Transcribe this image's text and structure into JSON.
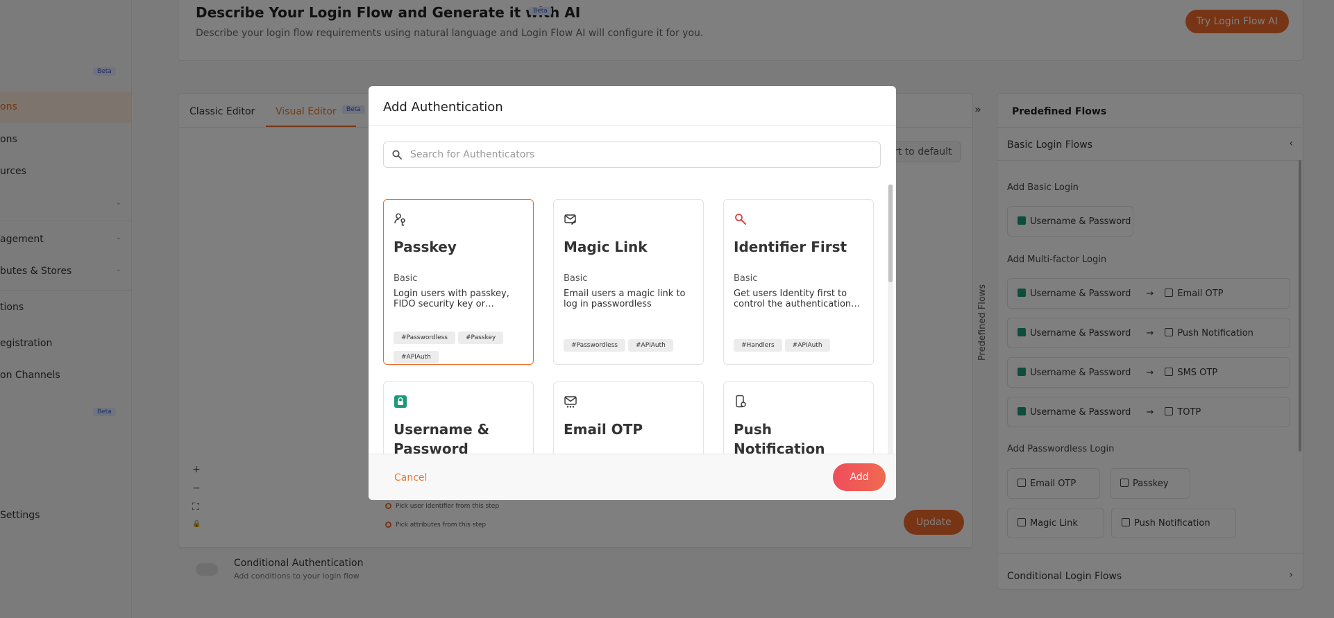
{
  "banner": {
    "title": "Describe Your Login Flow and Generate it with AI",
    "beta": "Beta",
    "subtitle": "Describe your login flow requirements using natural language and Login Flow AI will configure it for you.",
    "button": "Try Login Flow AI"
  },
  "sidebar": {
    "beta_1": "Beta",
    "beta_2": "Beta",
    "items": [
      {
        "label": "ons"
      },
      {
        "label": "ons"
      },
      {
        "label": "urces"
      },
      {
        "label": ""
      },
      {
        "label": "agement"
      },
      {
        "label": "butes & Stores"
      },
      {
        "label": "tions"
      },
      {
        "label": "egistration"
      },
      {
        "label": "on Channels"
      },
      {
        "label": "Settings"
      }
    ]
  },
  "editor": {
    "tab_classic": "Classic Editor",
    "tab_visual": "Visual Editor",
    "tab_beta": "Beta",
    "reset": "rt to default",
    "zoom_in": "+",
    "zoom_out": "−",
    "fit": "⛶",
    "lock": "🔒",
    "pick_1": "Pick user identifier from this step",
    "pick_2": "Pick attributes from this step",
    "update": "Update",
    "conditional_title": "Conditional Authentication",
    "conditional_sub": "Add conditions to your login flow"
  },
  "predefined": {
    "collapse_icon": "»",
    "vertical_label": "Predefined Flows",
    "title": "Predefined Flows",
    "basic_section": "Basic Login Flows",
    "add_basic": "Add Basic Login",
    "basic_chip": "Username & Password",
    "add_mfa": "Add Multi-factor Login",
    "mfa_rows": [
      {
        "first": "Username & Password",
        "second": "Email OTP"
      },
      {
        "first": "Username & Password",
        "second": "Push Notification"
      },
      {
        "first": "Username & Password",
        "second": "SMS OTP"
      },
      {
        "first": "Username & Password",
        "second": "TOTP"
      }
    ],
    "add_passwordless": "Add Passwordless Login",
    "passwordless": [
      "Email OTP",
      "Passkey",
      "Magic Link",
      "Push Notification"
    ],
    "conditional_section": "Conditional Login Flows"
  },
  "modal": {
    "title": "Add Authentication",
    "search_placeholder": "Search for Authenticators",
    "cards": [
      {
        "title": "Passkey",
        "category": "Basic",
        "description": "Login users with passkey, FIDO security key or…",
        "tags": [
          "#Passwordless",
          "#Passkey",
          "#APIAuth"
        ],
        "selected": true,
        "icon": "passkey-icon"
      },
      {
        "title": "Magic Link",
        "category": "Basic",
        "description": "Email users a magic link to log in passwordless",
        "tags": [
          "#Passwordless",
          "#APIAuth"
        ],
        "icon": "magic-link-icon"
      },
      {
        "title": "Identifier First",
        "category": "Basic",
        "description": "Get users Identity first to control the authentication…",
        "tags": [
          "#Handlers",
          "#APIAuth"
        ],
        "icon": "identifier-icon"
      },
      {
        "title": "Username & Password",
        "icon": "lock-icon"
      },
      {
        "title": "Email OTP",
        "icon": "email-otp-icon"
      },
      {
        "title": "Push Notification",
        "icon": "push-notification-icon"
      }
    ],
    "cancel": "Cancel",
    "add": "Add"
  },
  "colors": {
    "accent": "#ef6a2b",
    "add_button": "#ef4d5c",
    "lock_green": "#1a9a78",
    "identifier_red": "#e04444"
  }
}
